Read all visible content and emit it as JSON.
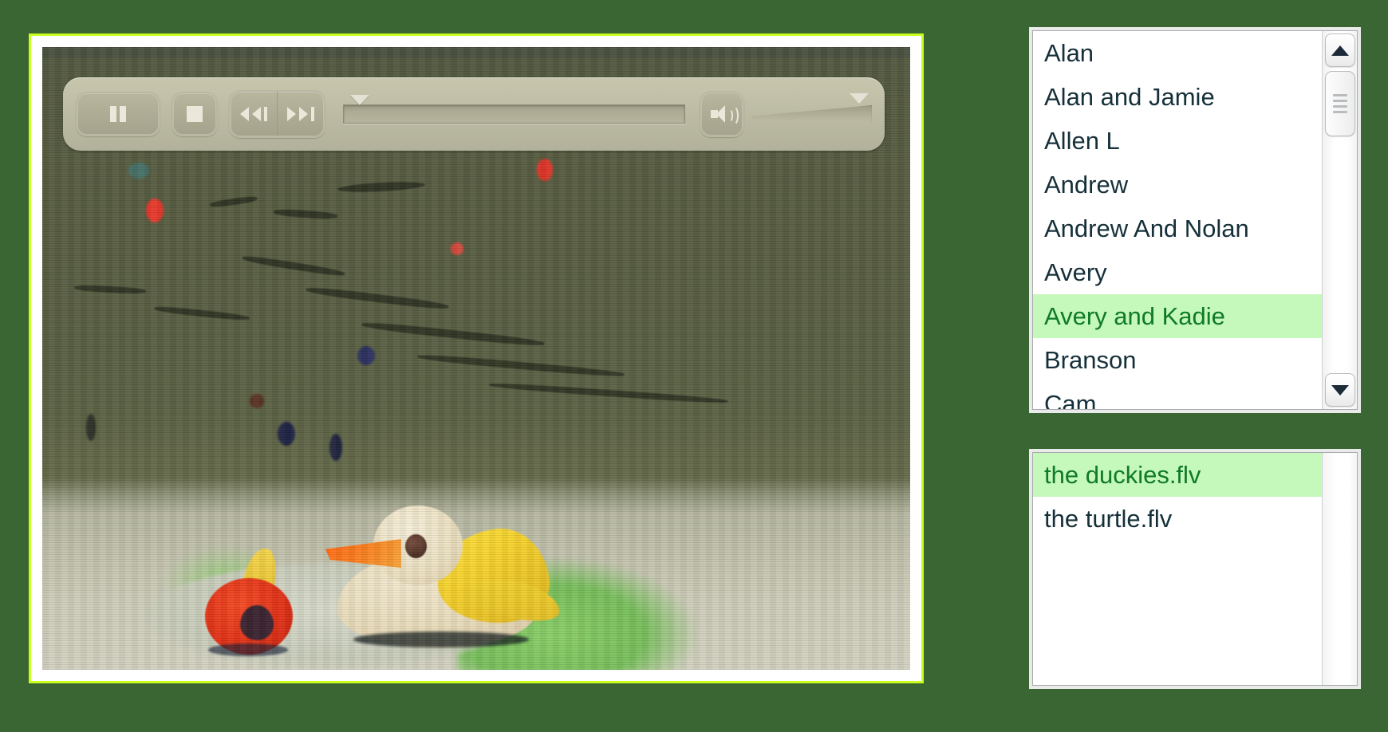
{
  "theme": {
    "page_background": "#3a6633",
    "video_border": "#c8ff1e",
    "selection_background": "#c5f8bb",
    "selection_text": "#0f7a28",
    "list_text": "#16303a",
    "control_bar": "#bdbca4"
  },
  "player": {
    "controls": {
      "pause_label": "Pause",
      "stop_label": "Stop",
      "rewind_label": "Rewind",
      "forward_label": "Fast Forward",
      "volume_label": "Volume",
      "seek_label": "Seek",
      "icons": {
        "pause": "pause-icon",
        "stop": "stop-icon",
        "rewind": "rewind-icon",
        "forward": "fast-forward-icon",
        "volume": "speaker-icon"
      },
      "seek_position_percent": 2,
      "volume_position_percent": 100
    },
    "video": {
      "description": "Claymation scene: a yellow and cream duck beside a small red bird on a pale oval base"
    }
  },
  "name_list": {
    "items": [
      {
        "label": "Alan",
        "selected": false
      },
      {
        "label": "Alan and Jamie",
        "selected": false
      },
      {
        "label": "Allen L",
        "selected": false
      },
      {
        "label": "Andrew",
        "selected": false
      },
      {
        "label": "Andrew And Nolan",
        "selected": false
      },
      {
        "label": "Avery",
        "selected": false
      },
      {
        "label": "Avery and Kadie",
        "selected": true
      },
      {
        "label": "Branson",
        "selected": false
      },
      {
        "label": "Cam",
        "selected": false
      }
    ],
    "scrollbar": {
      "up_icon": "chevron-up-icon",
      "down_icon": "chevron-down-icon"
    }
  },
  "file_list": {
    "items": [
      {
        "label": "the duckies.flv",
        "selected": true
      },
      {
        "label": "the turtle.flv",
        "selected": false
      }
    ]
  }
}
